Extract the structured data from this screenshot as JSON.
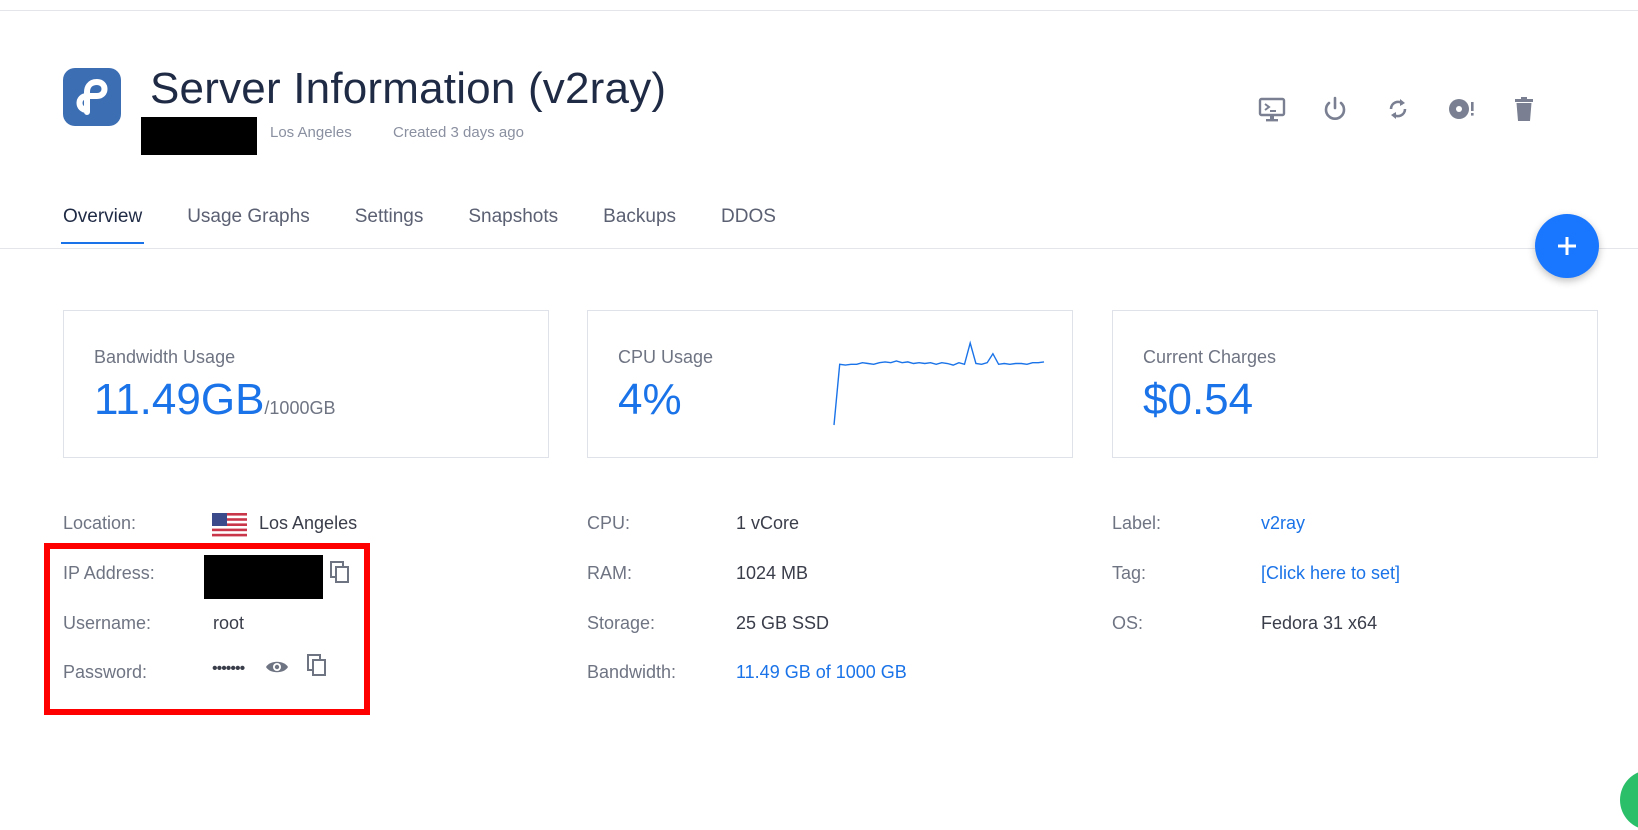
{
  "header": {
    "title": "Server Information (v2ray)",
    "location": "Los Angeles",
    "created": "Created 3 days ago",
    "actions": [
      "console-icon",
      "power-icon",
      "restart-icon",
      "reinstall-icon",
      "delete-icon"
    ]
  },
  "tabs": [
    {
      "label": "Overview",
      "active": true
    },
    {
      "label": "Usage Graphs"
    },
    {
      "label": "Settings"
    },
    {
      "label": "Snapshots"
    },
    {
      "label": "Backups"
    },
    {
      "label": "DDOS"
    }
  ],
  "fab": {
    "icon": "plus-icon",
    "label": "+"
  },
  "cards": {
    "bandwidth": {
      "label": "Bandwidth Usage",
      "value": "11.49GB",
      "unit": "/1000GB"
    },
    "cpu": {
      "label": "CPU Usage",
      "value": "4%"
    },
    "charges": {
      "label": "Current Charges",
      "value": "$0.54"
    }
  },
  "chart_data": {
    "type": "line",
    "series": [
      {
        "values": [
          0,
          74,
          73,
          74,
          74,
          76,
          75,
          74,
          76,
          77,
          76,
          78,
          76,
          77,
          75,
          76,
          75,
          76,
          74,
          76,
          75,
          73,
          76,
          74,
          100,
          75,
          74,
          76,
          87,
          74,
          75,
          74,
          75,
          75,
          74,
          76,
          76,
          77
        ]
      }
    ]
  },
  "details": {
    "col1": {
      "location": {
        "label": "Location:",
        "value": "Los Angeles"
      },
      "ip": {
        "label": "IP Address:"
      },
      "username": {
        "label": "Username:",
        "value": "root"
      },
      "password": {
        "label": "Password:",
        "value": "•••••••"
      }
    },
    "col2": {
      "cpu": {
        "label": "CPU:",
        "value": "1 vCore"
      },
      "ram": {
        "label": "RAM:",
        "value": "1024 MB"
      },
      "storage": {
        "label": "Storage:",
        "value": "25 GB SSD"
      },
      "bandwidth": {
        "label": "Bandwidth:",
        "value": "11.49 GB of 1000 GB"
      }
    },
    "col3": {
      "label": {
        "label": "Label:",
        "value": "v2ray"
      },
      "tag": {
        "label": "Tag:",
        "value": "[Click here to set]"
      },
      "os": {
        "label": "OS:",
        "value": "Fedora 31 x64"
      }
    }
  },
  "colors": {
    "accent": "#1a73e8",
    "fab": "#1976ff",
    "highlight": "#ff0000",
    "fedora": "#3c6eb4"
  }
}
